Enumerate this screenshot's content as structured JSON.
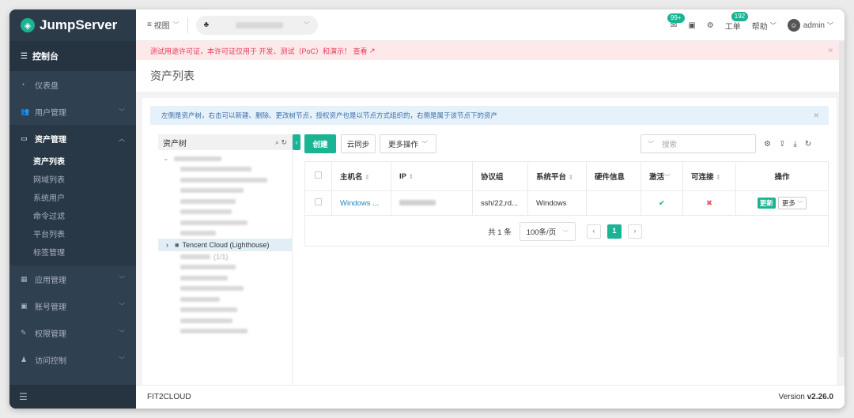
{
  "sidebar": {
    "logo": "JumpServer",
    "console": "控制台",
    "items": [
      {
        "label": "仪表盘",
        "icon": "dashboard-icon"
      },
      {
        "label": "用户管理",
        "icon": "users-icon"
      },
      {
        "label": "资产管理",
        "icon": "monitor-icon"
      },
      {
        "label": "应用管理",
        "icon": "grid-icon"
      },
      {
        "label": "账号管理",
        "icon": "account-icon"
      },
      {
        "label": "权限管理",
        "icon": "edit-icon"
      },
      {
        "label": "访问控制",
        "icon": "user-lock-icon"
      }
    ],
    "asset_sub": [
      "资产列表",
      "网域列表",
      "系统用户",
      "命令过滤",
      "平台列表",
      "标签管理"
    ]
  },
  "topbar": {
    "view": "视图",
    "badge_msg": "99+",
    "badge_ticket": "192",
    "ticket": "工单",
    "help": "帮助",
    "user": "admin"
  },
  "alert": "测试用途许可证，本许可证仅用于 开发、测试（PoC）和演示！ 查看",
  "page_title": "资产列表",
  "info": "左侧是资产树，右击可以新建、删除、更改树节点，授权资产也是以节点方式组织的，右侧是属于该节点下的资产",
  "tree": {
    "title": "资产树",
    "selected": "Tencent Cloud (Lighthouse)",
    "partial": "(1/1)"
  },
  "toolbar": {
    "create": "创建",
    "sync": "云同步",
    "more": "更多操作",
    "search_placeholder": "搜索"
  },
  "table": {
    "headers": [
      "主机名",
      "IP",
      "协议组",
      "系统平台",
      "硬件信息",
      "激活",
      "可连接",
      "操作"
    ],
    "rows": [
      {
        "hostname": "Windows ...",
        "protocols": "ssh/22,rd...",
        "platform": "Windows",
        "update": "更新",
        "more": "更多"
      }
    ]
  },
  "pager": {
    "total": "共 1 条",
    "size": "100条/页",
    "page": "1"
  },
  "footer": {
    "brand": "FIT2CLOUD",
    "version_label": "Version",
    "version": "v2.26.0"
  }
}
